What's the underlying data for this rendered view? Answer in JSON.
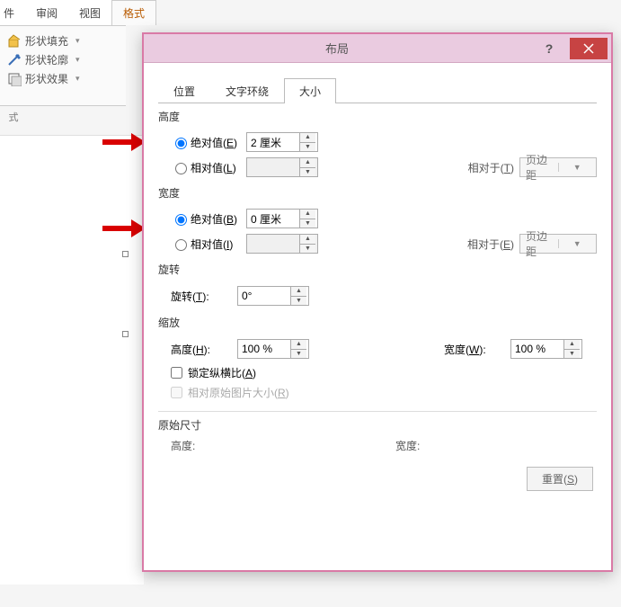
{
  "ribbon": {
    "tabs": {
      "review": "审阅",
      "view": "视图",
      "format": "格式"
    },
    "items": {
      "shape_fill": "形状填充",
      "shape_outline": "形状轮廓",
      "shape_effects": "形状效果"
    },
    "group_label": "式"
  },
  "dialog": {
    "title": "布局",
    "tabs": {
      "position": "位置",
      "wrap": "文字环绕",
      "size": "大小"
    },
    "height": {
      "title": "高度",
      "abs_label_pre": "绝对值(",
      "abs_key": "E",
      "abs_label_post": ")",
      "abs_value": "2 厘米",
      "rel_label_pre": "相对值(",
      "rel_key": "L",
      "rel_label_post": ")",
      "rel_value": "",
      "rel_to_pre": "相对于(",
      "rel_to_key": "T",
      "rel_to_post": ")",
      "rel_to_value": "页边距"
    },
    "width": {
      "title": "宽度",
      "abs_label_pre": "绝对值(",
      "abs_key": "B",
      "abs_label_post": ")",
      "abs_value": "0 厘米",
      "rel_label_pre": "相对值(",
      "rel_key": "I",
      "rel_label_post": ")",
      "rel_value": "",
      "rel_to_pre": "相对于(",
      "rel_to_key": "E",
      "rel_to_post": ")",
      "rel_to_value": "页边距"
    },
    "rotate": {
      "title": "旋转",
      "label_pre": "旋转(",
      "label_key": "T",
      "label_post": "):",
      "value": "0°"
    },
    "scale": {
      "title": "缩放",
      "h_pre": "高度(",
      "h_key": "H",
      "h_post": "):",
      "h_value": "100 %",
      "w_pre": "宽度(",
      "w_key": "W",
      "w_post": "):",
      "w_value": "100 %",
      "lock_pre": "锁定纵横比(",
      "lock_key": "A",
      "lock_post": ")",
      "orig_pre": "相对原始图片大小(",
      "orig_key": "R",
      "orig_post": ")"
    },
    "original": {
      "title": "原始尺寸",
      "h": "高度:",
      "w": "宽度:"
    },
    "reset_pre": "重置(",
    "reset_key": "S",
    "reset_post": ")"
  }
}
